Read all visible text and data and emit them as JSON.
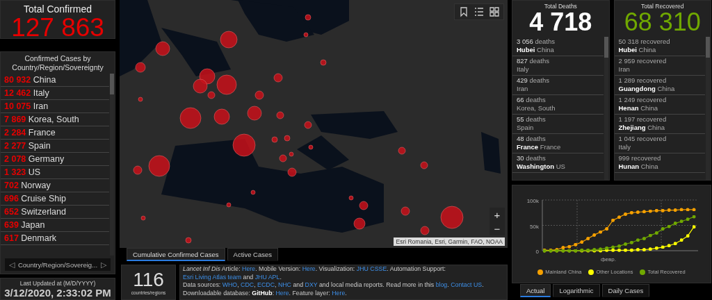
{
  "total_confirmed": {
    "label": "Total Confirmed",
    "value": "127 863"
  },
  "confirmed_list": {
    "title": "Confirmed Cases by Country/Region/Sovereignty",
    "items": [
      {
        "count": "80 932",
        "name": "China"
      },
      {
        "count": "12 462",
        "name": "Italy"
      },
      {
        "count": "10 075",
        "name": "Iran"
      },
      {
        "count": "7 869",
        "name": "Korea, South"
      },
      {
        "count": "2 284",
        "name": "France"
      },
      {
        "count": "2 277",
        "name": "Spain"
      },
      {
        "count": "2 078",
        "name": "Germany"
      },
      {
        "count": "1 323",
        "name": "US"
      },
      {
        "count": "702",
        "name": "Norway"
      },
      {
        "count": "696",
        "name": "Cruise Ship"
      },
      {
        "count": "652",
        "name": "Switzerland"
      },
      {
        "count": "639",
        "name": "Japan"
      },
      {
        "count": "617",
        "name": "Denmark"
      }
    ],
    "pager": {
      "prev": "◁",
      "label": "Country/Region/Sovereig...",
      "next": "▷"
    }
  },
  "last_updated": {
    "label": "Last Updated at (M/D/YYYY)",
    "value": "3/12/2020, 2:33:02 PM"
  },
  "map": {
    "attribution": "Esri Romania, Esri, Garmin, FAO, NOAA",
    "zoom_in": "+",
    "zoom_out": "−"
  },
  "map_tabs": [
    {
      "label": "Cumulative Confirmed Cases",
      "selected": true
    },
    {
      "label": "Active Cases",
      "selected": false
    }
  ],
  "countries": {
    "value": "116",
    "label": "countries/regions"
  },
  "info": [
    [
      {
        "kind": "italic",
        "text": "Lancet Inf Dis"
      },
      {
        "kind": "text",
        "text": " Article: "
      },
      {
        "kind": "link",
        "text": "Here"
      },
      {
        "kind": "text",
        "text": ". Mobile Version: "
      },
      {
        "kind": "link",
        "text": "Here"
      },
      {
        "kind": "text",
        "text": ". Visualization: "
      },
      {
        "kind": "link",
        "text": "JHU CSSE"
      },
      {
        "kind": "text",
        "text": ". Automation Support: "
      },
      {
        "kind": "link",
        "text": "Esri Living Atlas team"
      },
      {
        "kind": "text",
        "text": " and "
      },
      {
        "kind": "link",
        "text": "JHU APL"
      },
      {
        "kind": "text",
        "text": "."
      }
    ],
    [
      {
        "kind": "text",
        "text": "Data sources: "
      },
      {
        "kind": "link",
        "text": "WHO"
      },
      {
        "kind": "text",
        "text": ", "
      },
      {
        "kind": "link",
        "text": "CDC"
      },
      {
        "kind": "text",
        "text": ", "
      },
      {
        "kind": "link",
        "text": "ECDC"
      },
      {
        "kind": "text",
        "text": ", "
      },
      {
        "kind": "link",
        "text": "NHC"
      },
      {
        "kind": "text",
        "text": " and "
      },
      {
        "kind": "link",
        "text": "DXY"
      },
      {
        "kind": "text",
        "text": " and local media reports. Read more in this "
      },
      {
        "kind": "link",
        "text": "blog"
      },
      {
        "kind": "text",
        "text": ". "
      },
      {
        "kind": "link",
        "text": "Contact US"
      },
      {
        "kind": "text",
        "text": "."
      }
    ],
    [
      {
        "kind": "text",
        "text": "Downloadable database: "
      },
      {
        "kind": "strong",
        "text": "GitHub"
      },
      {
        "kind": "text",
        "text": ": "
      },
      {
        "kind": "link",
        "text": "Here"
      },
      {
        "kind": "text",
        "text": ". Feature layer: "
      },
      {
        "kind": "link",
        "text": "Here"
      },
      {
        "kind": "text",
        "text": "."
      }
    ]
  ],
  "deaths": {
    "label": "Total Deaths",
    "value": "4 718",
    "items": [
      {
        "count": "3 056",
        "unit": "deaths",
        "region": "Hubei",
        "country": "China"
      },
      {
        "count": "827",
        "unit": "deaths",
        "country": "Italy"
      },
      {
        "count": "429",
        "unit": "deaths",
        "country": "Iran"
      },
      {
        "count": "66",
        "unit": "deaths",
        "country": "Korea, South"
      },
      {
        "count": "55",
        "unit": "deaths",
        "country": "Spain"
      },
      {
        "count": "48",
        "unit": "deaths",
        "region": "France",
        "country": "France"
      },
      {
        "count": "30",
        "unit": "deaths",
        "region": "Washington",
        "country": "US"
      }
    ]
  },
  "recovered": {
    "label": "Total Recovered",
    "value": "68 310",
    "items": [
      {
        "count": "50 318",
        "unit": "recovered",
        "region": "Hubei",
        "country": "China"
      },
      {
        "count": "2 959",
        "unit": "recovered",
        "country": "Iran"
      },
      {
        "count": "1 289",
        "unit": "recovered",
        "region": "Guangdong",
        "country": "China"
      },
      {
        "count": "1 249",
        "unit": "recovered",
        "region": "Henan",
        "country": "China"
      },
      {
        "count": "1 197",
        "unit": "recovered",
        "region": "Zhejiang",
        "country": "China"
      },
      {
        "count": "1 045",
        "unit": "recovered",
        "country": "Italy"
      },
      {
        "count": "999",
        "unit": "recovered",
        "region": "Hunan",
        "country": "China"
      }
    ]
  },
  "chart": {
    "chart_data": {
      "type": "line",
      "ylim": [
        0,
        100000
      ],
      "legend": "bottom",
      "annotations": [
        "февр."
      ],
      "yticks": [
        {
          "value": 0,
          "label": "0"
        },
        {
          "value": 50000,
          "label": "50k"
        },
        {
          "value": 100000,
          "label": "100k"
        }
      ],
      "series": [
        {
          "name": "Mainland China",
          "color": "#f5a000",
          "values": [
            1000,
            1000,
            2000,
            6000,
            8000,
            12000,
            17000,
            24000,
            31000,
            37000,
            43000,
            60000,
            66000,
            72000,
            75000,
            76000,
            77000,
            78000,
            79000,
            79000,
            80000,
            80000,
            81000,
            81000,
            81000
          ]
        },
        {
          "name": "Other Locations",
          "color": "#ffff00",
          "values": [
            0,
            0,
            0,
            0,
            0,
            0,
            0,
            0,
            0,
            0,
            1000,
            1000,
            1000,
            1000,
            1000,
            2000,
            2000,
            3000,
            5000,
            7000,
            10000,
            14000,
            21000,
            29000,
            47000
          ]
        },
        {
          "name": "Total Recovered",
          "color": "#70a800",
          "values": [
            0,
            0,
            0,
            0,
            0,
            0,
            1000,
            1000,
            2000,
            3000,
            5000,
            7000,
            9000,
            13000,
            16000,
            21000,
            24000,
            30000,
            35000,
            43000,
            48000,
            54000,
            58000,
            62000,
            67000
          ]
        }
      ]
    }
  },
  "chart_tabs": [
    {
      "label": "Actual",
      "selected": true
    },
    {
      "label": "Logarithmic",
      "selected": false
    },
    {
      "label": "Daily Cases",
      "selected": false
    }
  ]
}
